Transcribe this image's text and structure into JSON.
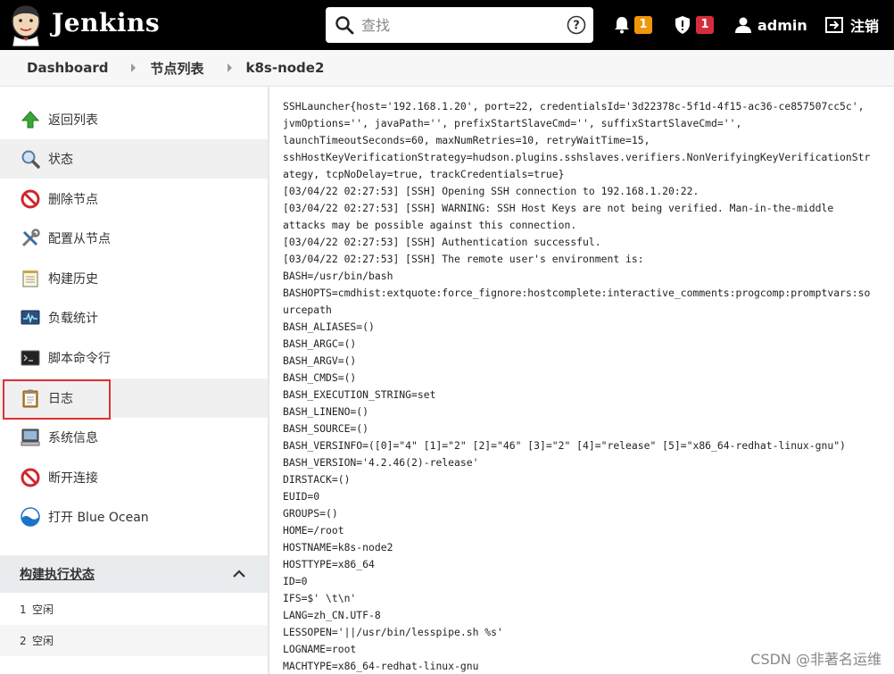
{
  "header": {
    "brand": "Jenkins",
    "search_placeholder": "查找",
    "notifications_count": "1",
    "security_count": "1",
    "user": "admin",
    "logout": "注销",
    "colors": {
      "bg": "#000000",
      "notif_badge": "#f0960a",
      "security_badge": "#d62d3e"
    }
  },
  "breadcrumb": {
    "items": [
      "Dashboard",
      "节点列表",
      "k8s-node2"
    ]
  },
  "sidebar": {
    "items": [
      {
        "label": "返回列表",
        "icon": "up-arrow-icon"
      },
      {
        "label": "状态",
        "icon": "magnifier-icon"
      },
      {
        "label": "删除节点",
        "icon": "no-entry-icon"
      },
      {
        "label": "配置从节点",
        "icon": "tools-icon"
      },
      {
        "label": "构建历史",
        "icon": "notepad-icon"
      },
      {
        "label": "负载统计",
        "icon": "monitor-graph-icon"
      },
      {
        "label": "脚本命令行",
        "icon": "terminal-icon"
      },
      {
        "label": "日志",
        "icon": "clipboard-icon"
      },
      {
        "label": "系统信息",
        "icon": "computer-icon"
      },
      {
        "label": "断开连接",
        "icon": "no-entry-icon"
      },
      {
        "label": "打开 Blue Ocean",
        "icon": "blue-ocean-icon"
      }
    ],
    "executors": {
      "title": "构建执行状态",
      "rows": [
        {
          "num": "1",
          "status": "空闲"
        },
        {
          "num": "2",
          "status": "空闲"
        }
      ]
    }
  },
  "console": {
    "lines": [
      "SSHLauncher{host='192.168.1.20', port=22, credentialsId='3d22378c-5f1d-4f15-ac36-ce857507cc5c',",
      "jvmOptions='', javaPath='', prefixStartSlaveCmd='', suffixStartSlaveCmd='',",
      "launchTimeoutSeconds=60, maxNumRetries=10, retryWaitTime=15,",
      "sshHostKeyVerificationStrategy=hudson.plugins.sshslaves.verifiers.NonVerifyingKeyVerificationStr",
      "ategy, tcpNoDelay=true, trackCredentials=true}",
      "[03/04/22 02:27:53] [SSH] Opening SSH connection to 192.168.1.20:22.",
      "[03/04/22 02:27:53] [SSH] WARNING: SSH Host Keys are not being verified. Man-in-the-middle",
      "attacks may be possible against this connection.",
      "[03/04/22 02:27:53] [SSH] Authentication successful.",
      "[03/04/22 02:27:53] [SSH] The remote user's environment is:",
      "BASH=/usr/bin/bash",
      "BASHOPTS=cmdhist:extquote:force_fignore:hostcomplete:interactive_comments:progcomp:promptvars:so",
      "urcepath",
      "BASH_ALIASES=()",
      "BASH_ARGC=()",
      "BASH_ARGV=()",
      "BASH_CMDS=()",
      "BASH_EXECUTION_STRING=set",
      "BASH_LINENO=()",
      "BASH_SOURCE=()",
      "BASH_VERSINFO=([0]=\"4\" [1]=\"2\" [2]=\"46\" [3]=\"2\" [4]=\"release\" [5]=\"x86_64-redhat-linux-gnu\")",
      "BASH_VERSION='4.2.46(2)-release'",
      "DIRSTACK=()",
      "EUID=0",
      "GROUPS=()",
      "HOME=/root",
      "HOSTNAME=k8s-node2",
      "HOSTTYPE=x86_64",
      "ID=0",
      "IFS=$' \\t\\n'",
      "LANG=zh_CN.UTF-8",
      "LESSOPEN='||/usr/bin/lesspipe.sh %s'",
      "LOGNAME=root",
      "MACHTYPE=x86_64-redhat-linux-gnu"
    ]
  },
  "watermark": "CSDN @非著名运维"
}
